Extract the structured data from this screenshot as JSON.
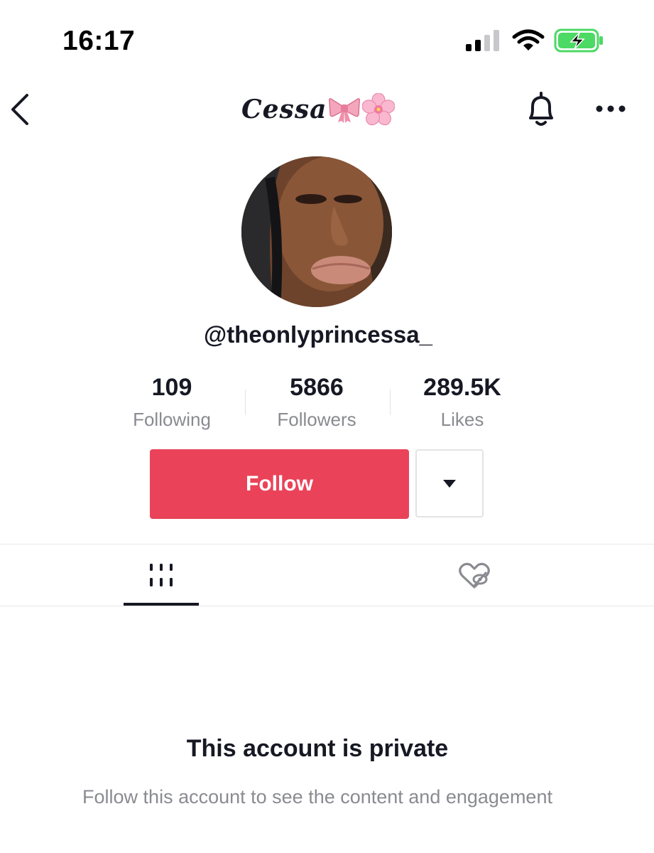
{
  "status_bar": {
    "time": "16:17",
    "icons": [
      "signal-icon",
      "wifi-icon",
      "battery-charging-icon"
    ],
    "battery_color": "#4cd964"
  },
  "nav": {
    "title": "Cessa",
    "title_emojis": [
      "ribbon-icon",
      "cherry-blossom-icon"
    ],
    "icons": [
      "back-icon",
      "bell-icon",
      "more-icon"
    ]
  },
  "profile": {
    "username": "@theonlyprincessa_",
    "stats": [
      {
        "value": "109",
        "label": "Following"
      },
      {
        "value": "5866",
        "label": "Followers"
      },
      {
        "value": "289.5K",
        "label": "Likes"
      }
    ],
    "follow_label": "Follow",
    "accent_color": "#ea4359"
  },
  "tabs": [
    {
      "icon": "grid-icon",
      "active": true
    },
    {
      "icon": "liked-hidden-icon",
      "active": false
    }
  ],
  "private": {
    "title": "This account is private",
    "subtitle": "Follow this account to see the content and engagement"
  }
}
